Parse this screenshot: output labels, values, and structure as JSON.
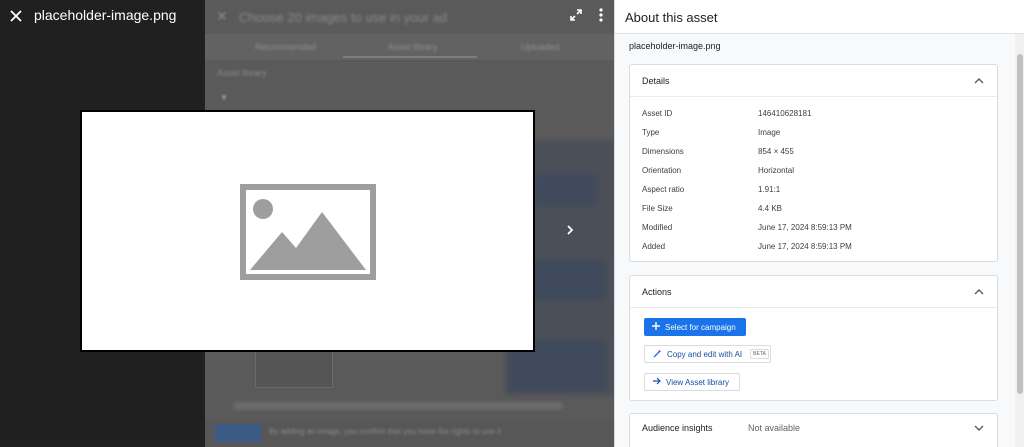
{
  "viewer": {
    "file_name": "placeholder-image.png",
    "icons": {
      "close": "close-icon",
      "expand": "expand-icon",
      "more": "more-vert-icon",
      "next": "chevron-right-icon",
      "image_placeholder": "image-placeholder-icon"
    }
  },
  "background_dialog": {
    "title": "Choose 20 images to use in your ad",
    "tabs": [
      "Recommended",
      "Asset library",
      "Uploaded"
    ],
    "section_label": "Asset library",
    "footer_text": "By adding an image, you confirm that you have the rights to use it"
  },
  "panel": {
    "title": "About this asset",
    "asset_name": "placeholder-image.png",
    "details": {
      "title": "Details",
      "rows": [
        {
          "label": "Asset ID",
          "value": "146410628181"
        },
        {
          "label": "Type",
          "value": "Image"
        },
        {
          "label": "Dimensions",
          "value": "854 × 455"
        },
        {
          "label": "Orientation",
          "value": "Horizontal"
        },
        {
          "label": "Aspect ratio",
          "value": "1.91:1"
        },
        {
          "label": "File Size",
          "value": "4.4 KB"
        },
        {
          "label": "Modified",
          "value": "June 17, 2024 8:59:13 PM"
        },
        {
          "label": "Added",
          "value": "June 17, 2024 8:59:13 PM"
        }
      ]
    },
    "actions": {
      "title": "Actions",
      "select_label": "Select for campaign",
      "copy_label": "Copy and edit with AI",
      "beta_label": "BETA",
      "view_label": "View Asset library"
    },
    "audience": {
      "title": "Audience insights",
      "value": "Not available"
    }
  },
  "colors": {
    "primary": "#1a73e8",
    "panel_bg": "#f8f9fa",
    "viewer_bg": "#202020",
    "placeholder_gray": "#9e9e9e"
  }
}
